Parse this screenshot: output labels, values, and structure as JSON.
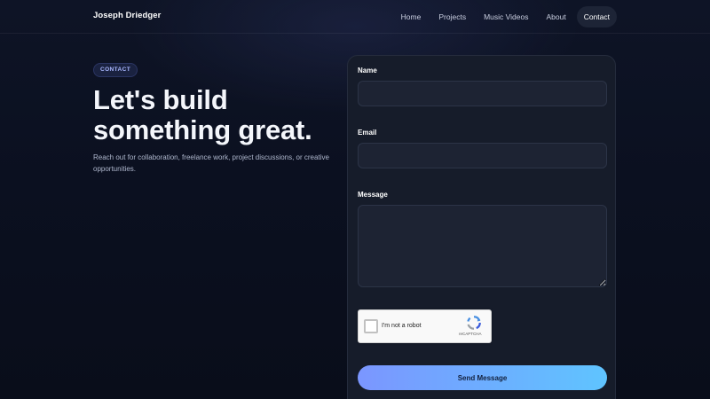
{
  "header": {
    "brand": "Joseph Driedger",
    "nav": [
      "Home",
      "Projects",
      "Music Videos",
      "About",
      "Contact"
    ],
    "active_nav": "Contact"
  },
  "hero": {
    "badge": "CONTACT",
    "headline": "Let's build something great.",
    "subtext": "Reach out for collaboration, freelance work, project discussions, or creative opportunities."
  },
  "form": {
    "name_label": "Name",
    "name_value": "",
    "email_label": "Email",
    "email_value": "",
    "message_label": "Message",
    "message_value": "",
    "captcha_label": "I'm not a robot",
    "captcha_brand": "reCAPTCHA",
    "submit_label": "Send Message"
  },
  "colors": {
    "background": "#0b1020",
    "card": "#161c2a",
    "accent_start": "#7b96ff",
    "accent_end": "#5fc4ff",
    "badge_text": "#a9b7ff"
  },
  "icons": [
    "recaptcha-logo-icon"
  ]
}
